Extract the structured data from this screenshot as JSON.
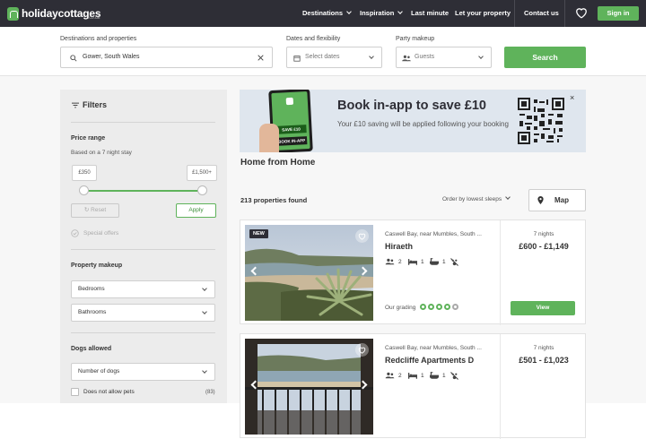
{
  "header": {
    "logo_text": "holidaycottages",
    "logo_sub": ".co.uk",
    "nav": [
      "Destinations",
      "Inspiration",
      "Last minute",
      "Let your property",
      "Contact us"
    ],
    "sign_in": "Sign in"
  },
  "search": {
    "destinations_label": "Destinations and properties",
    "destination_value": "Gower, South Wales",
    "dates_label": "Dates and flexibility",
    "dates_placeholder": "Select dates",
    "party_label": "Party makeup",
    "party_placeholder": "Guests",
    "search_button": "Search"
  },
  "filters": {
    "title": "Filters",
    "price_range_label": "Price range",
    "price_note": "Based on a 7 night stay",
    "price_min": "£350",
    "price_max": "£1,500+",
    "reset_label": "Reset",
    "apply_label": "Apply",
    "special_offers": "Special offers",
    "property_makeup_label": "Property makeup",
    "bedrooms": "Bedrooms",
    "bathrooms": "Bathrooms",
    "dogs_allowed_label": "Dogs allowed",
    "number_of_dogs": "Number of dogs",
    "no_pets_label": "Does not allow pets",
    "no_pets_count": "(83)"
  },
  "promo": {
    "title": "Book in-app to save £10",
    "text": "Your £10 saving will be applied following your booking",
    "phone_tag1": "SAVE £10",
    "phone_tag2": "BOOK IN-APP",
    "close": "×"
  },
  "results": {
    "section_title": "Home from Home",
    "count": "213 properties found",
    "order_by": "Order by lowest sleeps",
    "map_label": "Map"
  },
  "properties": [
    {
      "badge": "NEW",
      "location": "Caswell Bay, near Mumbles, South ...",
      "name": "Hiraeth",
      "sleeps": "2",
      "bedrooms": "1",
      "bathrooms": "1",
      "nights": "7 nights",
      "price": "£600 - £1,149",
      "grading_label": "Our grading",
      "grading": 4,
      "view_label": "View"
    },
    {
      "location": "Caswell Bay, near Mumbles, South ...",
      "name": "Redcliffe Apartments D",
      "sleeps": "2",
      "bedrooms": "1",
      "bathrooms": "1",
      "nights": "7 nights",
      "price": "£501 - £1,023"
    }
  ],
  "colors": {
    "nav_bg": "#2e2e36",
    "brand_green": "#5fb35b",
    "promo_bg": "#dfe6ee"
  }
}
